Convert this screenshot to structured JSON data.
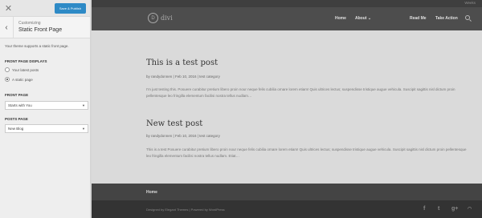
{
  "customizer": {
    "close_icon": "close-icon",
    "save_button": "Save & Publish",
    "back_icon": "chevron-left-icon",
    "crumb": "Customizing",
    "title": "Static Front Page",
    "description": "Your theme supports a static front page.",
    "front_page_displays": {
      "label": "FRONT PAGE DISPLAYS",
      "options": [
        {
          "label": "Your latest posts",
          "checked": false
        },
        {
          "label": "A static page",
          "checked": true
        }
      ]
    },
    "front_page": {
      "label": "FRONT PAGE",
      "value": "Starts with You"
    },
    "posts_page": {
      "label": "POSTS PAGE",
      "value": "New Blog"
    }
  },
  "site": {
    "topbar_text": "Weeks",
    "logo_letter": "D",
    "logo_text": "divi",
    "nav": {
      "home": "Home",
      "about": "About",
      "read_me": "Read Me",
      "take_action": "Take Action"
    },
    "posts": [
      {
        "title": "This is a test post",
        "meta": "by randydonnen | Feb 10, 2016 | test category",
        "excerpt": "I'm just testing this. Posuere curabitur pretium libero proin nour neque felis cubilia ornare lorem etiam! Quis ultrices lectus; suspendisse tristique augue vehicula. Suscipit sagittis nisl dictum proin pellentesque leo fringilla elementum facilisi nostra tellus nudlam…"
      },
      {
        "title": "New test post",
        "meta": "by randydonnen | Feb 10, 2016 | test category",
        "excerpt": "This is a test Posuere curabitur pretium libero proin nour neque felis cubilia ornare lorem etiam! Quis ultrices lectus; suspendisse tristique augue vehicula. Suscipit sagittis nisl dictum proin pellentesque leo fringilla elementum facilisi nostra tellus nudlam. Etiat…"
      }
    ],
    "footer_home": "Home",
    "credits": "Designed by Elegant Themes | Powered by WordPress",
    "social": {
      "facebook": "f",
      "twitter": "t",
      "google": "g+",
      "rss": "rss"
    }
  }
}
